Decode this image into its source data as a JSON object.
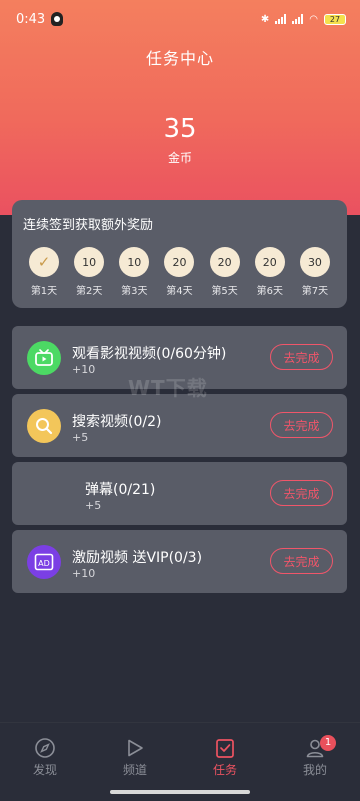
{
  "status": {
    "time": "0:43",
    "battery": "27"
  },
  "header": {
    "title": "任务中心"
  },
  "coins": {
    "value": "35",
    "label": "金币"
  },
  "checkin": {
    "title": "连续签到获取额外奖励",
    "days": [
      {
        "value": "✓",
        "label": "第1天",
        "done": true
      },
      {
        "value": "10",
        "label": "第2天"
      },
      {
        "value": "10",
        "label": "第3天"
      },
      {
        "value": "20",
        "label": "第4天"
      },
      {
        "value": "20",
        "label": "第5天"
      },
      {
        "value": "20",
        "label": "第6天"
      },
      {
        "value": "30",
        "label": "第7天"
      }
    ]
  },
  "tasks": [
    {
      "title": "观看影视视频(0/60分钟)",
      "reward": "+10",
      "button": "去完成",
      "icon": "tv-icon"
    },
    {
      "title": "搜索视频(0/2)",
      "reward": "+5",
      "button": "去完成",
      "icon": "search-icon"
    },
    {
      "title": "弹幕(0/21)",
      "reward": "+5",
      "button": "去完成",
      "icon": "none"
    },
    {
      "title": "激励视频 送VIP(0/3)",
      "reward": "+10",
      "button": "去完成",
      "icon": "ad-icon",
      "icon_text": "AD"
    }
  ],
  "watermark": "WT下载",
  "tabbar": {
    "items": [
      {
        "label": "发现",
        "icon": "compass-icon"
      },
      {
        "label": "频道",
        "icon": "play-icon"
      },
      {
        "label": "任务",
        "icon": "task-icon",
        "active": true
      },
      {
        "label": "我的",
        "icon": "user-icon",
        "badge": "1"
      }
    ]
  },
  "colors": {
    "accent": "#ec5361",
    "hero_top": "#f47f5e",
    "card": "#595c67",
    "background": "#2a2d39"
  }
}
